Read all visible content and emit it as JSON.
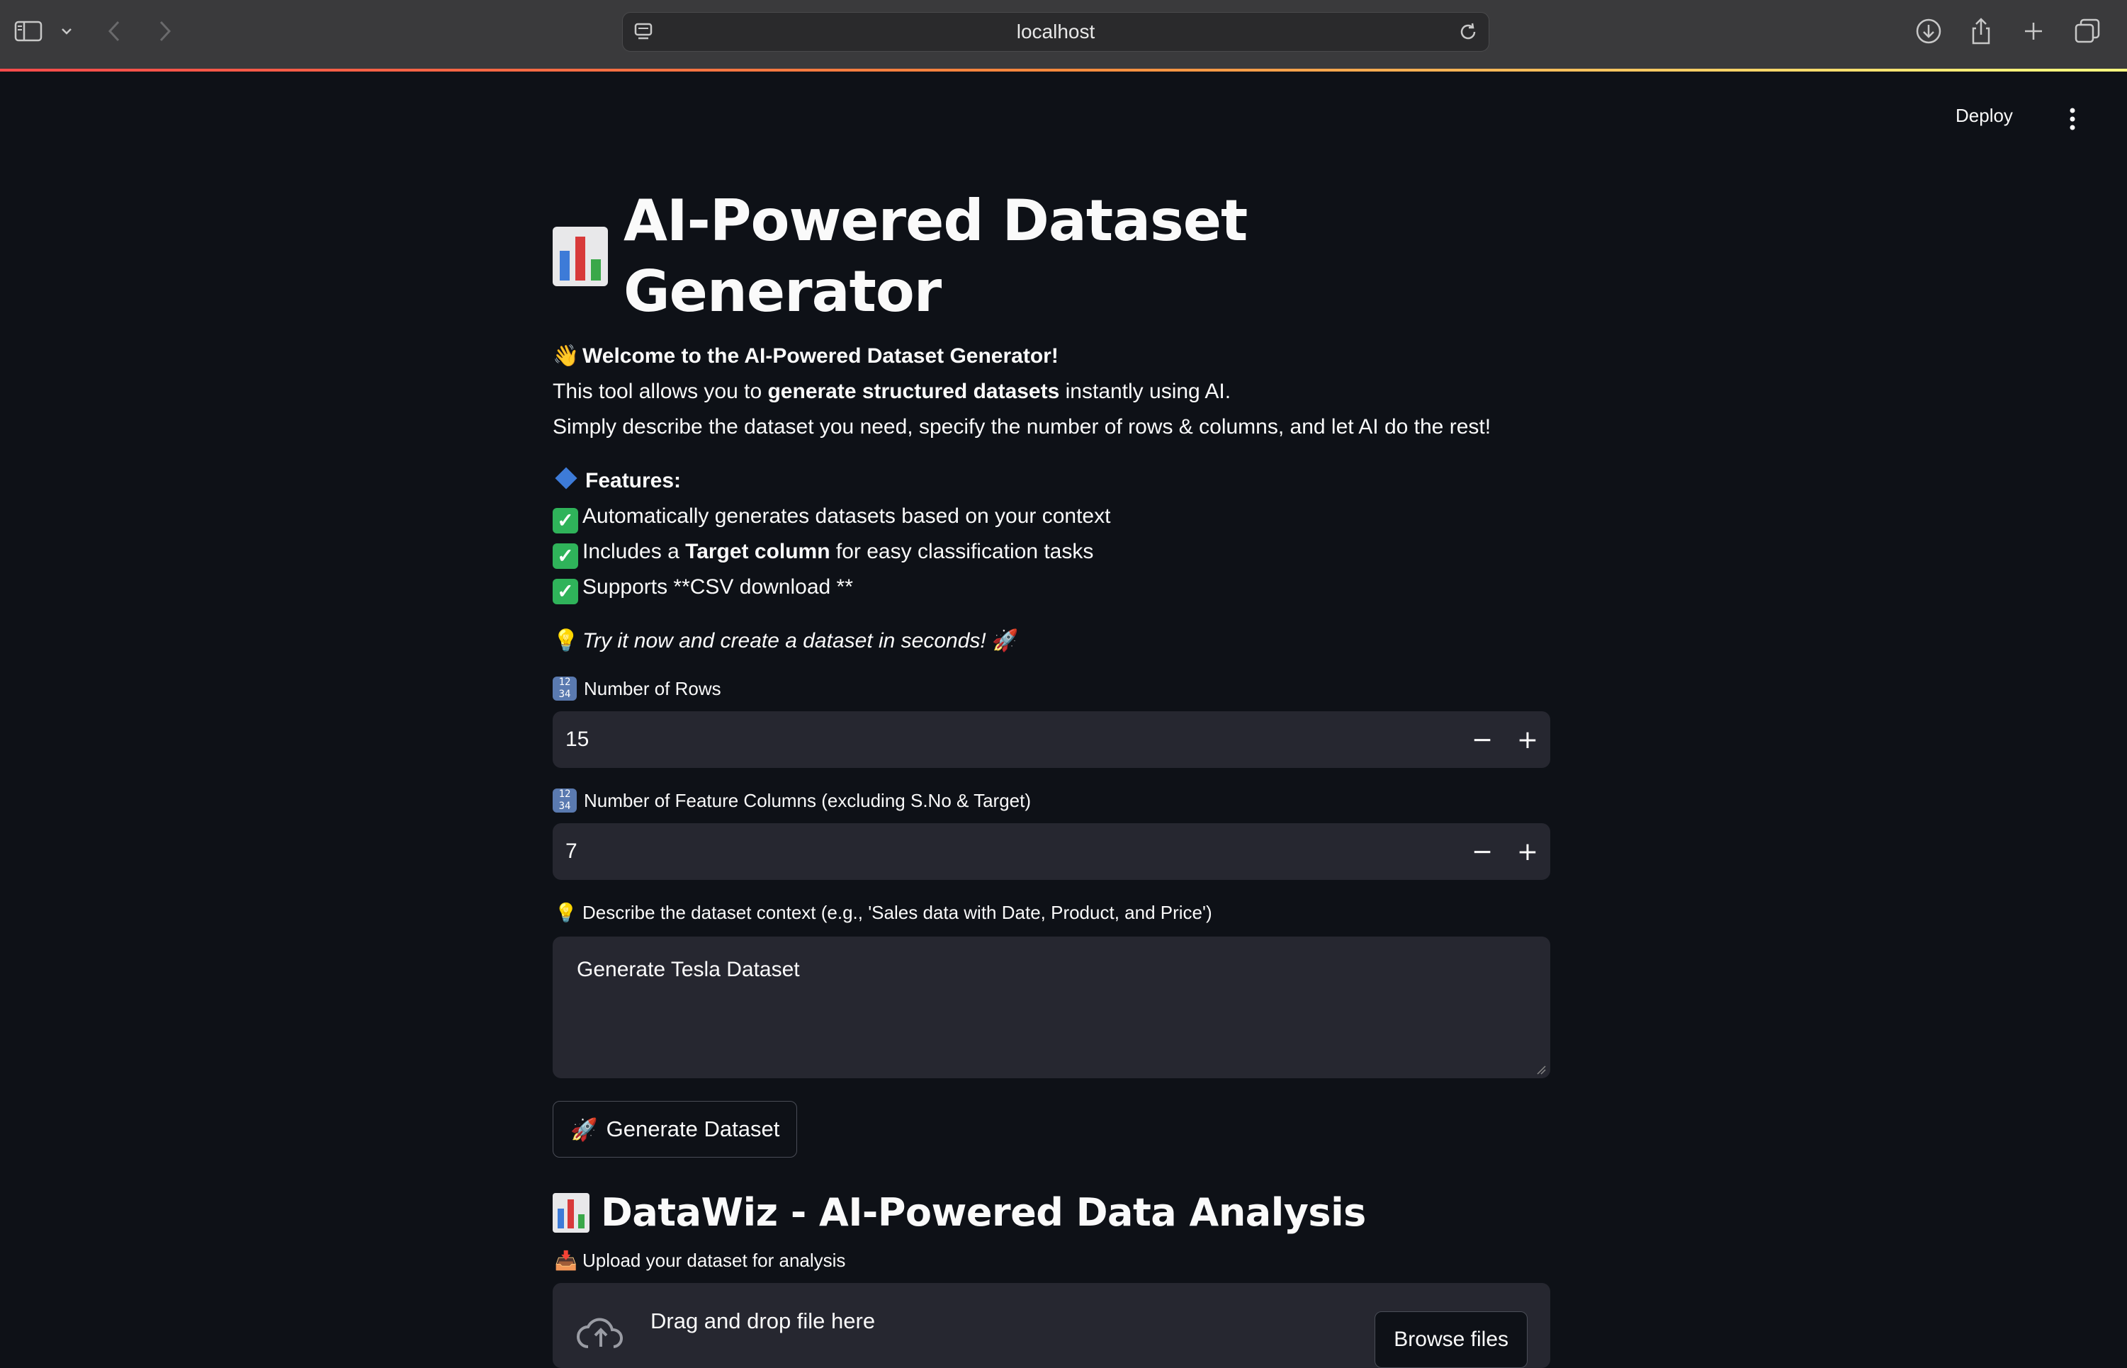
{
  "browser": {
    "url": "localhost"
  },
  "header": {
    "deploy_label": "Deploy"
  },
  "page": {
    "title": "AI-Powered Dataset Generator",
    "welcome": "Welcome to the AI-Powered Dataset Generator!",
    "intro_line1_pre": "This tool allows you to ",
    "intro_line1_bold": "generate structured datasets",
    "intro_line1_post": " instantly using AI.",
    "intro_line2": "Simply describe the dataset you need, specify the number of rows & columns, and let AI do the rest!",
    "features_heading": "Features:",
    "feature1": "Automatically generates datasets based on your context",
    "feature2_pre": "Includes a ",
    "feature2_bold": "Target column",
    "feature2_post": " for easy classification tasks",
    "feature3": "Supports **CSV download **",
    "try_it": "Try it now and create a dataset in seconds!"
  },
  "form": {
    "rows_label": "Number of Rows",
    "rows_value": "15",
    "cols_label": "Number of Feature Columns (excluding S.No & Target)",
    "cols_value": "7",
    "context_label": "Describe the dataset context (e.g., 'Sales data with Date, Product, and Price')",
    "context_value": "Generate Tesla Dataset",
    "generate_button": "Generate Dataset",
    "decrement_symbol": "−",
    "increment_symbol": "+"
  },
  "analysis": {
    "heading": "DataWiz - AI-Powered Data Analysis",
    "upload_label": "Upload your dataset for analysis",
    "drag_drop": "Drag and drop file here",
    "browse_button": "Browse files"
  },
  "colors": {
    "background": "#0e1117",
    "input_bg": "#262730",
    "chrome_bg": "#3a3a3c",
    "check_green": "#2fb35a"
  },
  "icons": {
    "sidebar": "sidebar-icon",
    "back": "chevron-left-icon",
    "forward": "chevron-right-icon",
    "download": "download-icon",
    "share": "share-icon",
    "new_tab": "plus-icon",
    "tabs": "tabs-icon",
    "menu": "kebab-icon"
  }
}
